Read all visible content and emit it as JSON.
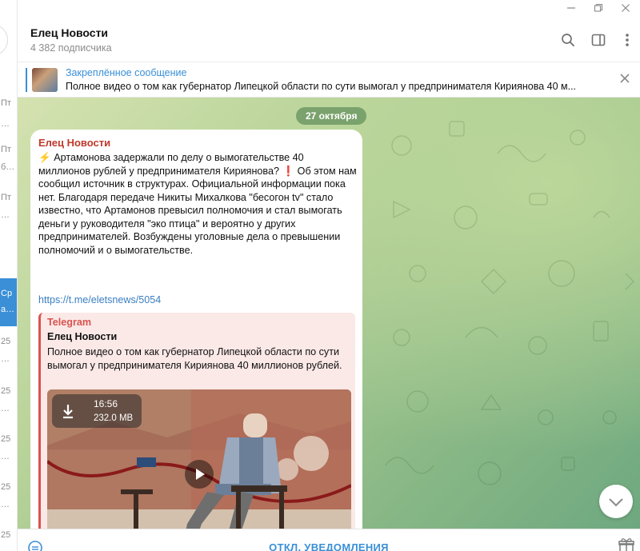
{
  "window": {
    "controls": [
      "minimize",
      "restore",
      "close"
    ]
  },
  "chat_list": {
    "rows": [
      {
        "top": "Пт",
        "sub": "…"
      },
      {
        "top": "Пт",
        "sub": "б…"
      },
      {
        "top": "Пт",
        "sub": "…"
      },
      {
        "top": "Ср",
        "sub": "а…",
        "active": true
      },
      {
        "top": "25",
        "sub": "…"
      },
      {
        "top": "25",
        "sub": "…"
      },
      {
        "top": "25",
        "sub": "…"
      },
      {
        "top": "25",
        "sub": "…"
      },
      {
        "top": "25",
        "sub": ""
      }
    ]
  },
  "header": {
    "title": "Елец Новости",
    "subtitle": "4 382 подписчика",
    "icons": [
      "search-icon",
      "sidebar-toggle-icon",
      "more-vertical-icon"
    ]
  },
  "pinned": {
    "label": "Закреплённое сообщение",
    "text": "Полное видео о том как губернатор Липецкой области по сути вымогал у предпринимателя Кириянова 40 м..."
  },
  "chat": {
    "date": "27 октября",
    "message": {
      "author": "Елец Новости",
      "zap": "⚡",
      "text_part1": "Артамонова задержали по делу о вымогательстве 40 миллионов рублей у предпринимателя Кириянова?",
      "exclaim": "❗",
      "text_part2": "Об этом нам сообщил источник в структурах. Официальной информации пока нет.  Благодаря передаче Никиты Михалкова \"бесогон tv\" стало известно, что Артамонов превысил полномочия и стал вымогать деньги у руководителя \"эко птица\" и вероятно у других предпринимателей. Возбуждены уголовные дела о превышении полномочий и о вымогательстве.",
      "link": "https://t.me/eletsnews/5054",
      "preview": {
        "site": "Telegram",
        "title": "Елец Новости",
        "description": "Полное видео о том как губернатор Липецкой области по сути вымогал у предпринимателя Кириянова 40 миллионов рублей.",
        "video": {
          "duration": "16:56",
          "size": "232.0 MB"
        }
      }
    }
  },
  "bottom": {
    "mute_label": "ОТКЛ. УВЕДОМЛЕНИЯ"
  },
  "colors": {
    "accent": "#3a8fd6",
    "author": "#c0392b",
    "preview_accent": "#d9534f"
  }
}
